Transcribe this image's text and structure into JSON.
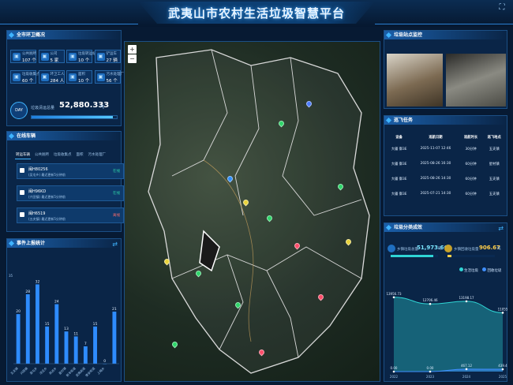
{
  "header": {
    "title": "武夷山市农村生活垃圾智慧平台"
  },
  "overview": {
    "title": "全市环卫概况",
    "stats": [
      {
        "label": "公共厕所",
        "value": "107 个"
      },
      {
        "label": "公司",
        "value": "5 家"
      },
      {
        "label": "垃圾转运站",
        "value": "10 个"
      },
      {
        "label": "铲运车",
        "value": "27 辆"
      },
      {
        "label": "垃圾收集点",
        "value": "60 个"
      },
      {
        "label": "环卫工人",
        "value": "284 人"
      },
      {
        "label": "面积",
        "value": "10 个"
      },
      {
        "label": "污水处理厂",
        "value": "56 个"
      }
    ],
    "badge": "DAY",
    "daily_label": "垃圾清运总量",
    "daily_value": "52,880.333",
    "daily_unit": "吨",
    "daily_progress": 0.95
  },
  "vehicles": {
    "title": "在线车辆",
    "tabs": [
      "转运车辆",
      "公共厕所",
      "垃圾收集点",
      "面积",
      "污水处理厂"
    ],
    "rows": [
      {
        "plate": "闽H80256",
        "sub": "(吴屯乡) 最近更新5分钟前",
        "status": "在线",
        "color": "#2fd5a8"
      },
      {
        "plate": "闽H96KD",
        "sub": "(兴田镇) 最近更新5分钟前",
        "status": "在线",
        "color": "#2fd5a8"
      },
      {
        "plate": "闽H6519",
        "sub": "(五夫镇) 最近更新5分钟前",
        "status": "离线",
        "color": "#ff6b6b"
      }
    ]
  },
  "events": {
    "title": "事件上报统计",
    "ymax": "35",
    "categories": [
      "五夫镇",
      "兴田镇",
      "吴屯乡",
      "洋庄乡",
      "岚谷乡",
      "星村镇",
      "新丰街道",
      "武夷街道",
      "崇安街道",
      "上梅乡"
    ],
    "values": [
      20,
      28,
      32,
      15,
      24,
      13,
      11,
      7,
      15,
      0,
      21
    ]
  },
  "map": {
    "zoom_in": "+",
    "zoom_out": "−"
  },
  "video": {
    "title": "垃圾站点监控"
  },
  "patrol": {
    "title": "巡飞任务",
    "headers": [
      "设备",
      "巡航日期",
      "巡航时长",
      "巡飞地点"
    ],
    "rows": [
      [
        "大疆 御3E",
        "2025-11-07 12:46",
        "30分钟",
        "五夫镇"
      ],
      [
        "大疆 御3E",
        "2025-08-26 16:30",
        "60分钟",
        "星村镇"
      ],
      [
        "大疆 御3E",
        "2025-08-26 14:30",
        "60分钟",
        "五夫镇"
      ],
      [
        "大疆 御3E",
        "2025-07-21 14:30",
        "60分钟",
        "五夫镇"
      ]
    ]
  },
  "sorting": {
    "title": "垃圾分类成效",
    "a_label": "乡镇垃圾总量",
    "a_value": "51,973.66",
    "a_unit": "吨",
    "b_label": "乡镇回收垃圾量",
    "b_value": "906.67",
    "b_unit": "吨",
    "legend": [
      "生活垃圾",
      "回收垃圾"
    ]
  },
  "chart_data": {
    "type": "area",
    "x": [
      "2022",
      "2023",
      "2024",
      "2025"
    ],
    "series": [
      {
        "name": "生活垃圾",
        "values": [
          13956.73,
          12706.46,
          13198.17,
          11055
        ]
      },
      {
        "name": "回收垃圾",
        "values": [
          0,
          0,
          467.12,
          439.4
        ]
      }
    ],
    "labels_top": [
      "13956.73",
      "12706.46",
      "13198.17",
      "11055"
    ],
    "labels_bottom": [
      "0.00",
      "0.00",
      "467.12",
      "439.4"
    ]
  }
}
